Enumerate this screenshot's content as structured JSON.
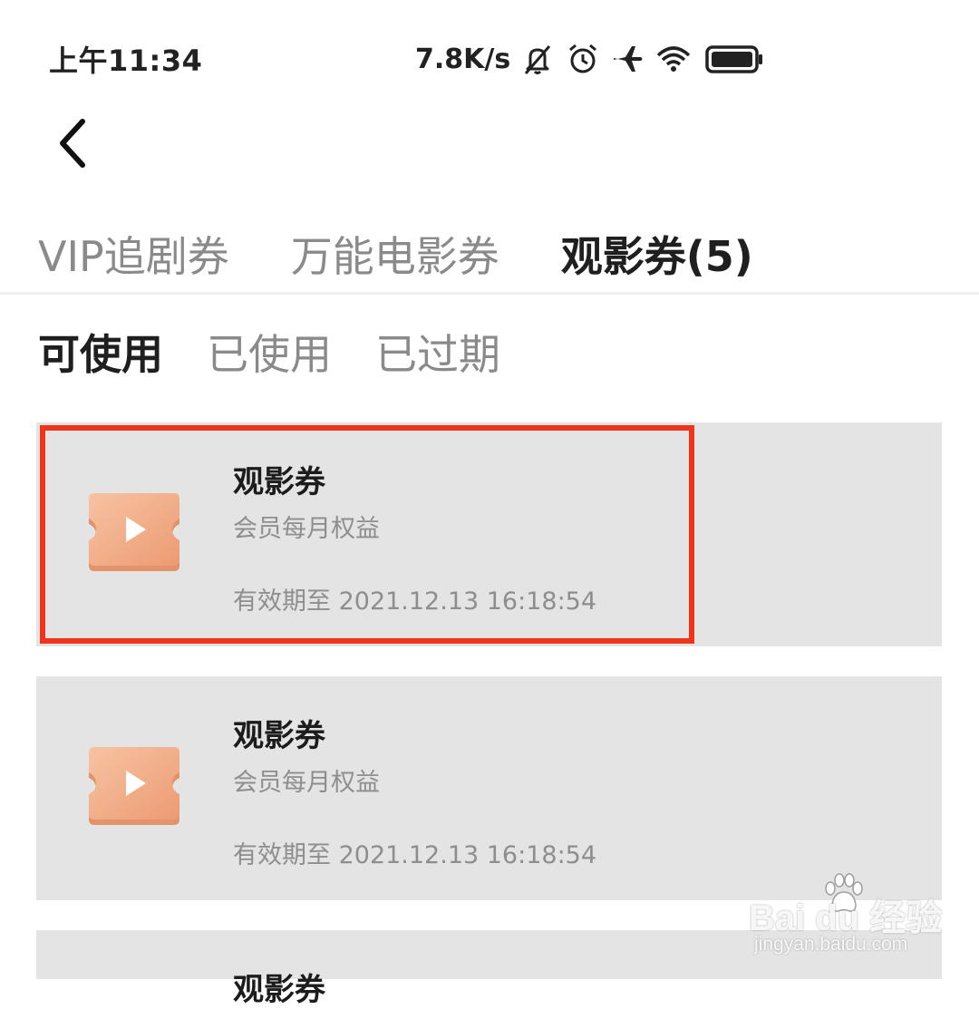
{
  "status_bar": {
    "time": "上午11:34",
    "net_speed": "7.8K/s",
    "icons": [
      "bell-off-icon",
      "alarm-icon",
      "airplane-icon",
      "wifi-icon",
      "battery-icon"
    ]
  },
  "nav": {
    "back_icon": "chevron-left-icon"
  },
  "tabs": [
    {
      "label": "VIP追剧券",
      "active": false
    },
    {
      "label": "万能电影券",
      "active": false
    },
    {
      "label": "观影券(5)",
      "active": true
    }
  ],
  "subtabs": [
    {
      "label": "可使用",
      "active": true
    },
    {
      "label": "已使用",
      "active": false
    },
    {
      "label": "已过期",
      "active": false
    }
  ],
  "coupons": [
    {
      "title": "观影券",
      "subtitle": "会员每月权益",
      "validity": "有效期至 2021.12.13 16:18:54",
      "icon": "ticket-play-icon"
    },
    {
      "title": "观影券",
      "subtitle": "会员每月权益",
      "validity": "有效期至 2021.12.13 16:18:54",
      "icon": "ticket-play-icon"
    },
    {
      "title": "观影券",
      "subtitle": "",
      "validity": "",
      "icon": "ticket-play-icon"
    }
  ],
  "colors": {
    "highlight": "#f0331b",
    "card_bg": "#e4e4e4",
    "ticket": "#f0a882"
  },
  "watermark": {
    "brand": "Bai du 经验",
    "url": "jingyan.baidu.com"
  }
}
